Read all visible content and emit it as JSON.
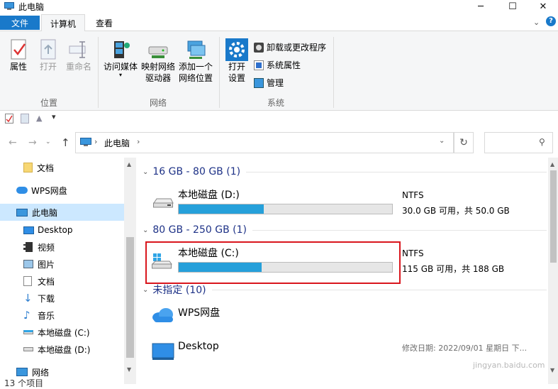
{
  "window": {
    "title": "此电脑"
  },
  "tabs": [
    {
      "label": "文件"
    },
    {
      "label": "计算机"
    },
    {
      "label": "查看"
    }
  ],
  "ribbon": {
    "location_group": {
      "label": "位置",
      "buttons": [
        {
          "label": "属性"
        },
        {
          "label": "打开"
        },
        {
          "label": "重命名"
        }
      ]
    },
    "network_group": {
      "label": "网络",
      "access_media": "访问媒体",
      "map_drive_line1": "映射网络",
      "map_drive_line2": "驱动器",
      "add_location_line1": "添加一个",
      "add_location_line2": "网络位置"
    },
    "system_group": {
      "label": "系统",
      "open_settings_line1": "打开",
      "open_settings_line2": "设置",
      "uninstall": "卸载或更改程序",
      "system_props": "系统属性",
      "manage": "管理"
    }
  },
  "address": {
    "path": "此电脑"
  },
  "nav": {
    "items": [
      {
        "label": "文档",
        "icon": "folder-icon"
      },
      {
        "label": "WPS网盘",
        "icon": "cloud-icon"
      },
      {
        "label": "此电脑",
        "icon": "computer-icon"
      },
      {
        "label": "Desktop",
        "icon": "desktop-icon"
      },
      {
        "label": "视频",
        "icon": "video-icon"
      },
      {
        "label": "图片",
        "icon": "picture-icon"
      },
      {
        "label": "文档",
        "icon": "document-icon"
      },
      {
        "label": "下载",
        "icon": "download-icon"
      },
      {
        "label": "音乐",
        "icon": "music-icon"
      },
      {
        "label": "本地磁盘 (C:)",
        "icon": "drive-c-icon"
      },
      {
        "label": "本地磁盘 (D:)",
        "icon": "drive-d-icon"
      },
      {
        "label": "网络",
        "icon": "network-icon"
      }
    ],
    "status": "13 个项目"
  },
  "groups": [
    {
      "header": "16 GB - 80 GB (1)"
    },
    {
      "header": "80 GB - 250 GB (1)"
    },
    {
      "header": "未指定 (10)"
    }
  ],
  "drives": [
    {
      "name": "本地磁盘 (D:)",
      "fs": "NTFS",
      "space": "30.0 GB 可用，共 50.0 GB",
      "used_fraction": 0.4
    },
    {
      "name": "本地磁盘 (C:)",
      "fs": "NTFS",
      "space": "115 GB 可用，共 188 GB",
      "used_fraction": 0.39
    }
  ],
  "unspecified": [
    {
      "name": "WPS网盘"
    },
    {
      "name": "Desktop",
      "modified": "修改日期: 2022/09/01 星期日 下..."
    }
  ],
  "colors": {
    "accent": "#1979ca",
    "bar_fill": "#26a0da",
    "highlight_box": "#d9161d",
    "group_header": "#1e3287"
  },
  "watermark": "jingyan.baidu.com"
}
